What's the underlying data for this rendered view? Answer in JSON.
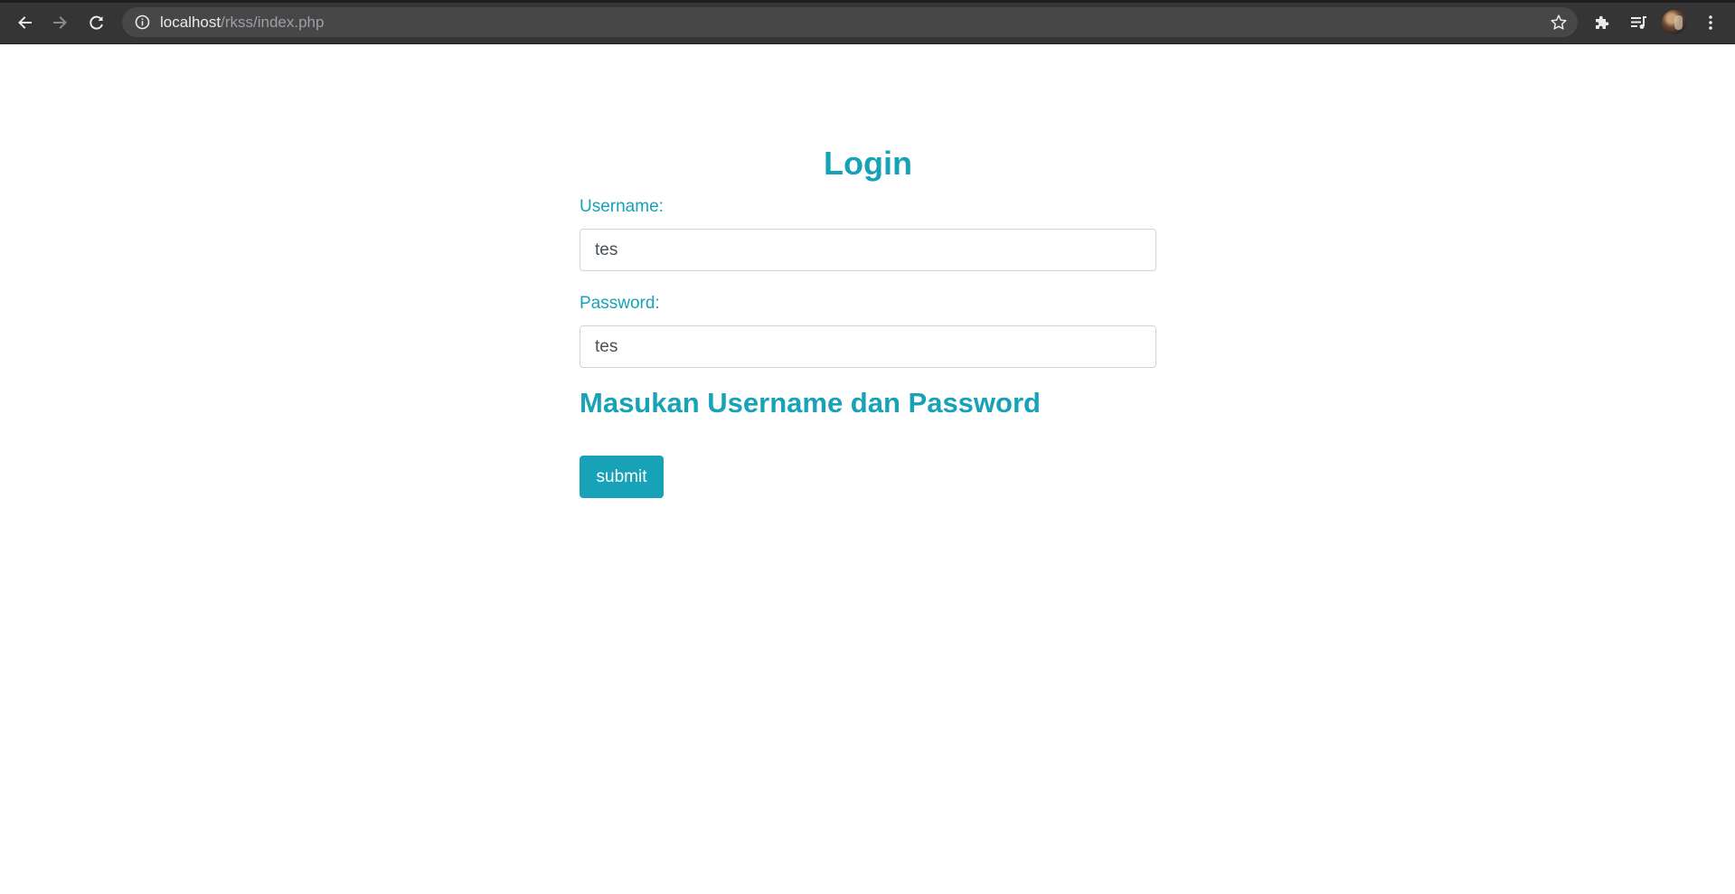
{
  "browser": {
    "url_host": "localhost",
    "url_path": "/rkss/index.php",
    "icons": {
      "back": "back-arrow-icon",
      "forward": "forward-arrow-icon",
      "reload": "reload-icon",
      "site_info": "info-icon",
      "bookmark": "star-icon",
      "extensions": "puzzle-icon",
      "media": "media-queue-icon",
      "profile": "avatar",
      "menu": "kebab-menu-icon"
    }
  },
  "login": {
    "title": "Login",
    "username_label": "Username:",
    "username_value": "tes",
    "password_label": "Password:",
    "password_value": "tes",
    "message": "Masukan Username dan Password",
    "submit_label": "submit"
  },
  "colors": {
    "accent": "#17a2b8",
    "chrome_bg": "#353535",
    "omnibox_bg": "#474747"
  }
}
